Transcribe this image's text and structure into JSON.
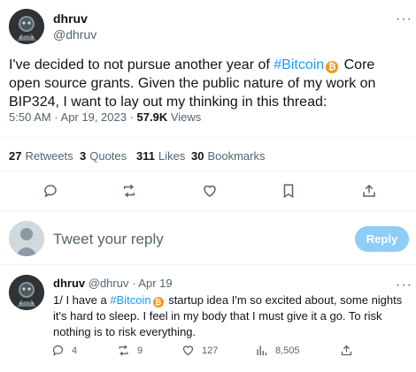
{
  "main_tweet": {
    "author_name": "dhruv",
    "author_handle": "@dhruv",
    "more_label": "···",
    "text_before": "I've decided to not pursue another year of ",
    "hashtag": "#Bitcoin",
    "text_after": " Core open source grants. Given the public nature of my work on BIP324, I want to lay out my thinking in this thread:",
    "time": "5:50 AM · Apr 19, 2023 · ",
    "views_count": "57.9K",
    "views_label": " Views"
  },
  "stats": {
    "retweets_count": "27",
    "retweets_label": "Retweets",
    "quotes_count": "3",
    "quotes_label": "Quotes",
    "likes_count": "311",
    "likes_label": "Likes",
    "bookmarks_count": "30",
    "bookmarks_label": "Bookmarks"
  },
  "reply_box": {
    "placeholder": "Tweet your reply",
    "button_label": "Reply"
  },
  "thread_tweet": {
    "author_name": "dhruv",
    "author_handle": "@dhruv · Apr 19",
    "more_label": "···",
    "text_before": "1/ I have a ",
    "hashtag": "#Bitcoin",
    "text_after": " startup idea I'm so excited about, some nights it's hard to sleep. I feel in my body that I must give it a go. To risk nothing is to risk everything.",
    "replies": "4",
    "retweets": "9",
    "likes": "127",
    "views": "8,505"
  },
  "colors": {
    "link": "#1d9bf0",
    "bitcoin": "#f7931a",
    "reply_button": "#8ecdf7"
  }
}
